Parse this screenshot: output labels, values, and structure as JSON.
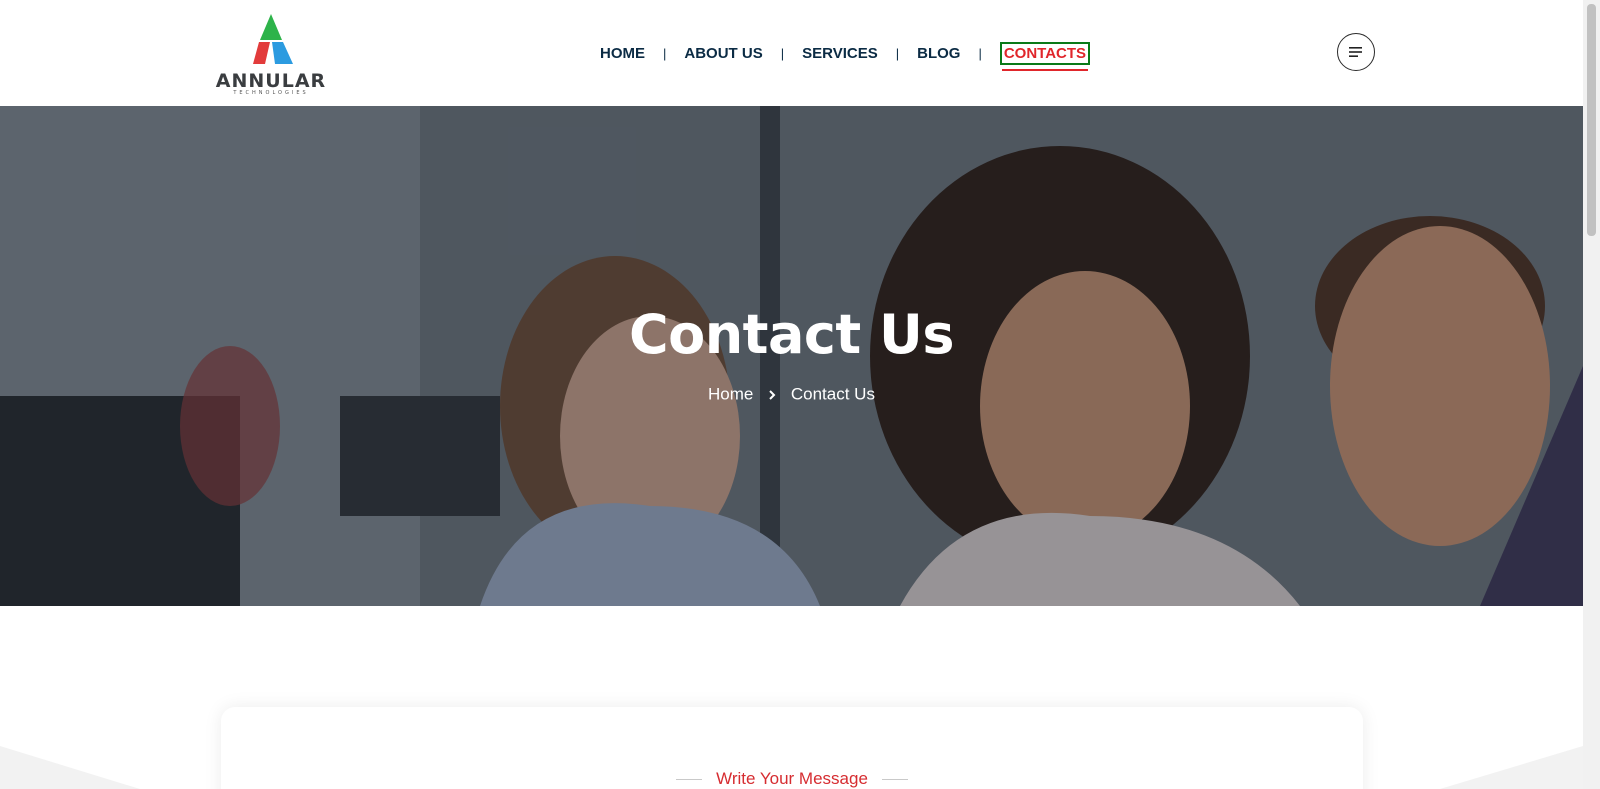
{
  "logo": {
    "name": "ANNULAR",
    "tagline": "TECHNOLOGIES"
  },
  "nav": {
    "items": [
      {
        "label": "HOME"
      },
      {
        "label": "ABOUT US"
      },
      {
        "label": "SERVICES"
      },
      {
        "label": "BLOG"
      },
      {
        "label": "CONTACTS",
        "active": true
      }
    ],
    "separator": "|",
    "menu_icon": "hamburger-icon"
  },
  "hero": {
    "title": "Contact Us",
    "breadcrumb": {
      "home": "Home",
      "current": "Contact Us"
    }
  },
  "form_card": {
    "subtitle": "Write Your Message"
  },
  "colors": {
    "nav_text": "#0b2b44",
    "accent_red": "#e0262b",
    "active_outline": "#0a7a18",
    "hero_text": "#ffffff"
  }
}
